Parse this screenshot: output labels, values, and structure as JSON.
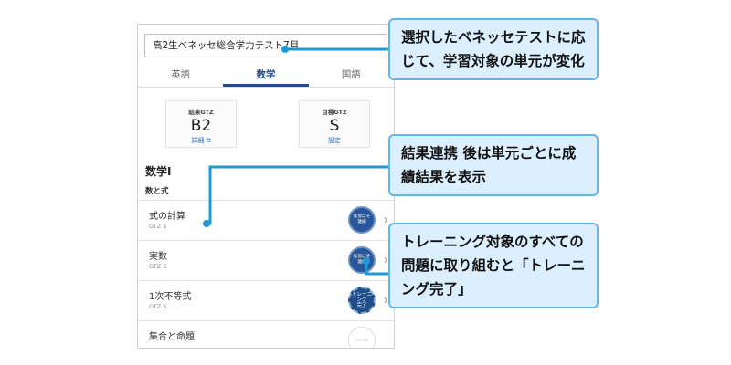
{
  "test_select": {
    "value": "高2生ベネッセ総合学力テスト7月"
  },
  "tabs": [
    {
      "label": "英語"
    },
    {
      "label": "数学"
    },
    {
      "label": "国語"
    }
  ],
  "gtz": {
    "result": {
      "title": "結果GTZ",
      "value": "B2",
      "link": "詳細"
    },
    "target": {
      "title": "目標GTZ",
      "value": "S",
      "link": "設定"
    }
  },
  "subject": "数学Ⅰ",
  "section": "数と式",
  "units": [
    {
      "name": "式の計算",
      "gtz": "GTZ S",
      "badge": "復習ぱそ\n連続",
      "status": "in-progress"
    },
    {
      "name": "実数",
      "gtz": "GTZ S",
      "badge": "復習ぱそ\n連続",
      "status": "in-progress"
    },
    {
      "name": "1次不等式",
      "gtz": "GTZ S",
      "badge": "トレーニング\n完了",
      "status": "done"
    },
    {
      "name": "集合と命題",
      "gtz": "",
      "badge": "comp",
      "status": "empty"
    }
  ],
  "callouts": [
    "選択したベネッセテストに応じて、学習対象の単元が変化",
    "結果連携 後は単元ごとに成績結果を表示",
    "トレーニング対象のすべての問題に取り組むと「トレーニング完了」"
  ],
  "colors": {
    "accent": "#1f4e8a",
    "callout_bg": "#dcefff",
    "callout_border": "#63b6e8",
    "connector": "#1e9ad6"
  }
}
